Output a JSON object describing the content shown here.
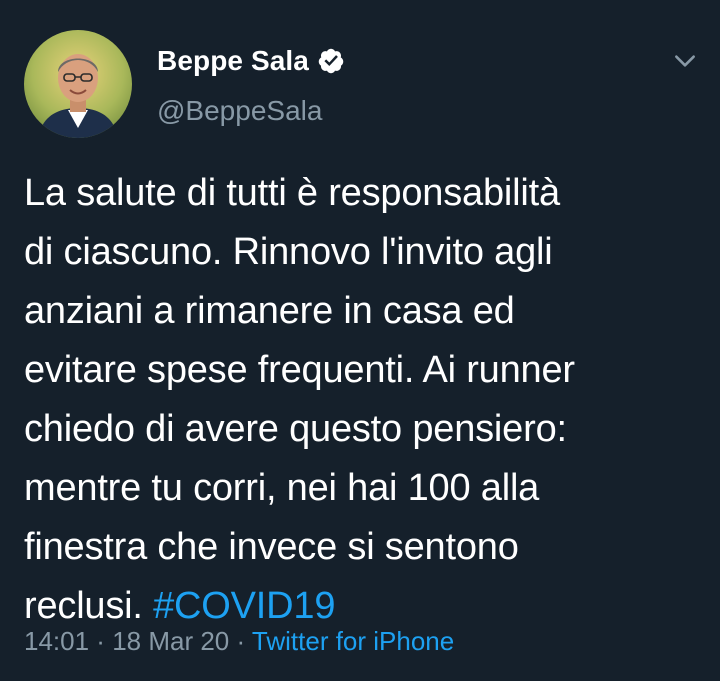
{
  "author": {
    "display_name": "Beppe Sala",
    "handle": "@BeppeSala",
    "verified": true,
    "avatar_icon": "profile-photo"
  },
  "tweet": {
    "lines": [
      "La salute di tutti è responsabilità",
      "di ciascuno. Rinnovo l'invito agli",
      "anziani a rimanere in casa ed",
      "evitare spese frequenti. Ai runner",
      "chiedo di avere questo pensiero:",
      "mentre tu corri, nei hai 100 alla",
      "finestra che invece si sentono"
    ],
    "last_line_prefix": "reclusi. ",
    "hashtag": "#COVID19"
  },
  "meta": {
    "time": "14:01",
    "separator_1": " · ",
    "date": "18 Mar 20",
    "separator_2": " · ",
    "source": "Twitter for iPhone"
  },
  "icons": {
    "verified_badge": "verified-badge-icon",
    "menu_caret": "chevron-down-icon"
  },
  "colors": {
    "background": "#15202b",
    "text": "#ffffff",
    "secondary": "#8899a6",
    "accent": "#1da1f2"
  }
}
